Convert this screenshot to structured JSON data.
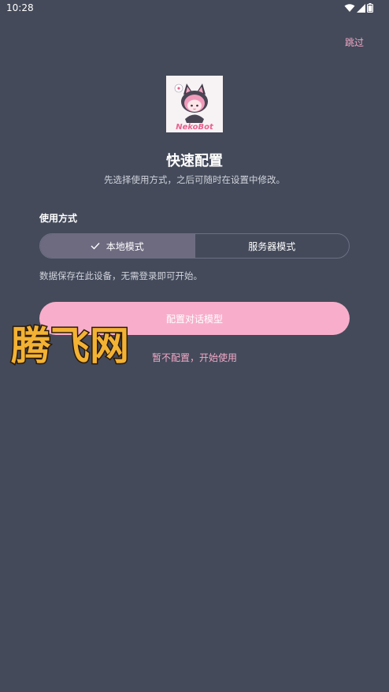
{
  "status_bar": {
    "time": "10:28",
    "icons": [
      "wifi-icon",
      "signal-icon",
      "battery-icon"
    ]
  },
  "skip_label": "跳过",
  "logo": {
    "brand_text": "NekoBot",
    "brand_color": "#e8628f"
  },
  "title": "快速配置",
  "subtitle": "先选择使用方式，之后可随时在设置中修改。",
  "usage": {
    "section_label": "使用方式",
    "options": [
      {
        "label": "本地模式",
        "selected": true
      },
      {
        "label": "服务器模式",
        "selected": false
      }
    ],
    "description": "数据保存在此设备，无需登录即可开始。"
  },
  "primary_button_label": "配置对话模型",
  "secondary_link_label": "暂不配置，开始使用",
  "watermark_text": "腾飞网",
  "colors": {
    "background": "#444a5a",
    "accent_pink": "#f8aecb",
    "link_pink": "#f2a9c7",
    "selected_option": "#6e6a80",
    "watermark_fill": "#f3b234",
    "watermark_stroke": "#2a1a0a"
  }
}
